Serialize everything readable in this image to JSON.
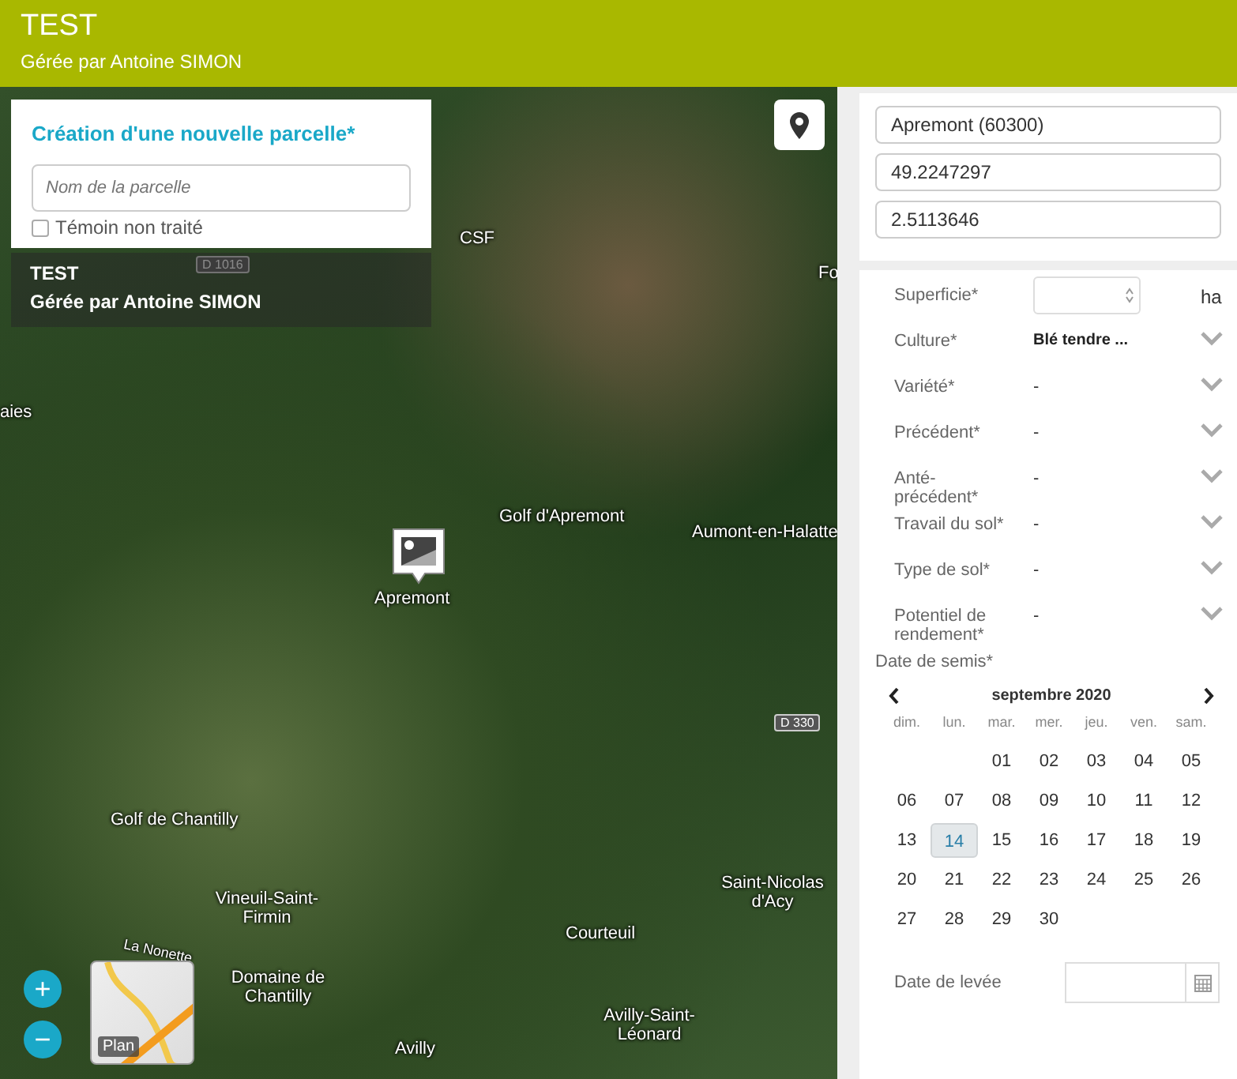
{
  "header": {
    "title": "TEST",
    "subtitle": "Gérée par Antoine SIMON"
  },
  "new_parcel": {
    "title": "Création d'une nouvelle parcelle*",
    "name_field": {
      "placeholder": "Nom de la parcelle"
    },
    "checkbox": {
      "label": "Témoin non traité",
      "checked": false
    }
  },
  "map_overlay": {
    "title": "TEST",
    "subtitle": "Gérée par Antoine SIMON"
  },
  "map": {
    "labels": [
      {
        "text": "CSF",
        "kind": "place"
      },
      {
        "text": "D 1016",
        "kind": "road"
      },
      {
        "text": "Fo",
        "kind": "place"
      },
      {
        "text": "aies",
        "kind": "place"
      },
      {
        "text": "Golf d'Apremont",
        "kind": "place"
      },
      {
        "text": "Aumont-en-Halatte",
        "kind": "place"
      },
      {
        "text": "D 330",
        "kind": "road"
      },
      {
        "text": "Golf de Chantilly",
        "kind": "place"
      },
      {
        "text": "Saint-Nicolas d'Acy",
        "kind": "place"
      },
      {
        "text": "Courteuil",
        "kind": "place"
      },
      {
        "text": "Vineuil-Saint-Firmin",
        "kind": "place"
      },
      {
        "text": "La Nonette",
        "kind": "river"
      },
      {
        "text": "Domaine de Chantilly",
        "kind": "place"
      },
      {
        "text": "Avilly-Saint-Léonard",
        "kind": "place"
      },
      {
        "text": "Avilly",
        "kind": "place"
      }
    ],
    "marker_label": "Apremont",
    "zoom_in": "+",
    "zoom_out": "−",
    "layer_button": "Plan"
  },
  "location": {
    "fields": [
      "Apremont (60300)",
      "49.2247297",
      "2.5113646"
    ]
  },
  "form": {
    "rows": [
      {
        "label": "Superficie*",
        "kind": "number",
        "unit": "ha"
      },
      {
        "label": "Culture*",
        "kind": "select",
        "value": "Blé tendre ..."
      },
      {
        "label": "Variété*",
        "kind": "select",
        "value": "-"
      },
      {
        "label": "Précédent*",
        "kind": "select",
        "value": "-"
      },
      {
        "label": "Anté-précédent*",
        "kind": "select",
        "value": "-"
      },
      {
        "label": "Travail du sol*",
        "kind": "select",
        "value": "-"
      },
      {
        "label": "Type de sol*",
        "kind": "select",
        "value": "-"
      },
      {
        "label": "Potentiel de rendement*",
        "kind": "select",
        "value": "-"
      }
    ],
    "sowing_date": {
      "label": "Date de semis*",
      "calendar": {
        "month": "septembre 2020",
        "weekdays": [
          "dim.",
          "lun.",
          "mar.",
          "mer.",
          "jeu.",
          "ven.",
          "sam."
        ],
        "weeks": [
          {
            "kind": "first",
            "days": [
              {
                "day": "01",
                "selected": false
              },
              {
                "day": "02",
                "selected": false
              },
              {
                "day": "03",
                "selected": false
              },
              {
                "day": "04",
                "selected": false
              },
              {
                "day": "05",
                "selected": false
              }
            ]
          },
          {
            "kind": "full",
            "days": [
              {
                "day": "06",
                "selected": false
              },
              {
                "day": "07",
                "selected": false
              },
              {
                "day": "08",
                "selected": false
              },
              {
                "day": "09",
                "selected": false
              },
              {
                "day": "10",
                "selected": false
              },
              {
                "day": "11",
                "selected": false
              },
              {
                "day": "12",
                "selected": false
              }
            ]
          },
          {
            "kind": "full",
            "days": [
              {
                "day": "13",
                "selected": false
              },
              {
                "day": "14",
                "selected": true
              },
              {
                "day": "15",
                "selected": false
              },
              {
                "day": "16",
                "selected": false
              },
              {
                "day": "17",
                "selected": false
              },
              {
                "day": "18",
                "selected": false
              },
              {
                "day": "19",
                "selected": false
              }
            ]
          },
          {
            "kind": "full",
            "days": [
              {
                "day": "20",
                "selected": false
              },
              {
                "day": "21",
                "selected": false
              },
              {
                "day": "22",
                "selected": false
              },
              {
                "day": "23",
                "selected": false
              },
              {
                "day": "24",
                "selected": false
              },
              {
                "day": "25",
                "selected": false
              },
              {
                "day": "26",
                "selected": false
              }
            ]
          },
          {
            "kind": "last",
            "days": [
              {
                "day": "27",
                "selected": false
              },
              {
                "day": "28",
                "selected": false
              },
              {
                "day": "29",
                "selected": false
              },
              {
                "day": "30",
                "selected": false
              }
            ]
          }
        ]
      }
    },
    "emergence_date": {
      "label": "Date de levée"
    }
  }
}
